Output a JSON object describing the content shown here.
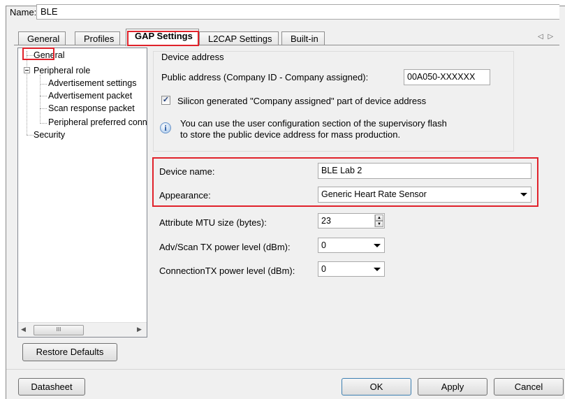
{
  "header": {
    "name_label": "Name:",
    "name_value": "BLE"
  },
  "tabs": [
    {
      "label": "General"
    },
    {
      "label": "Profiles"
    },
    {
      "label": "GAP Settings"
    },
    {
      "label": "L2CAP Settings"
    },
    {
      "label": "Built-in"
    }
  ],
  "tab_scroll": "◁ ▷",
  "tree": {
    "items": [
      {
        "label": "General"
      },
      {
        "label": "Peripheral role"
      },
      {
        "label": "Advertisement settings"
      },
      {
        "label": "Advertisement packet"
      },
      {
        "label": "Scan response packet"
      },
      {
        "label": "Peripheral preferred connection parameters"
      },
      {
        "label": "Security"
      }
    ],
    "scroll_thumb": "III"
  },
  "device_address": {
    "group_title": "Device address",
    "public_label": "Public address (Company ID - Company assigned):",
    "public_value": "00A050-XXXXXX",
    "silicon_checked": "✓",
    "silicon_label": "Silicon generated \"Company assigned\" part of device address",
    "info_icon": "i",
    "info_line1": "You can use the user configuration section of the supervisory flash",
    "info_line2": "to store the public device address for mass production."
  },
  "fields": {
    "device_name_label": "Device name:",
    "device_name_value": "BLE Lab 2",
    "appearance_label": "Appearance:",
    "appearance_value": "Generic Heart Rate Sensor",
    "mtu_label": "Attribute MTU size (bytes):",
    "mtu_value": "23",
    "adv_tx_label": "Adv/Scan TX power level (dBm):",
    "adv_tx_value": "0",
    "conn_tx_label": "ConnectionTX power level (dBm):",
    "conn_tx_value": "0"
  },
  "buttons": {
    "restore_defaults": "Restore Defaults",
    "datasheet": "Datasheet",
    "ok": "OK",
    "apply": "Apply",
    "cancel": "Cancel"
  },
  "colors": {
    "highlight": "#e0222b",
    "background": "#f0f0f0"
  }
}
